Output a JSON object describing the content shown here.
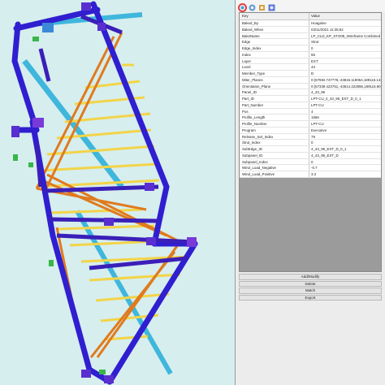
{
  "toolbar": {
    "icons": [
      "color-wheel-icon",
      "gear-icon",
      "wrench-icon",
      "filter-icon"
    ]
  },
  "properties": {
    "headers": {
      "key": "Key",
      "value": "Value"
    },
    "rows": [
      {
        "key": "Baked_By",
        "value": "Hoagaine"
      },
      {
        "key": "Baked_When",
        "value": "03/11/2021 11:35:52"
      },
      {
        "key": "BakeName",
        "value": "LP_CLD_KP_STG09_Wireframe Combined Po..."
      },
      {
        "key": "Edge",
        "value": "Strut"
      },
      {
        "key": "Edge_Index",
        "value": "0"
      },
      {
        "key": "Index",
        "value": "55"
      },
      {
        "key": "Layer",
        "value": "EXT"
      },
      {
        "key": "Level",
        "value": "43"
      },
      {
        "key": "Member_Type",
        "value": "D"
      },
      {
        "key": "Miter_Planes",
        "value": "0:(67592.747776,-43815.119054,189115.143..."
      },
      {
        "key": "Orientation_Plane",
        "value": "0:(57339.423751,-43614.222886,189115.907..."
      },
      {
        "key": "Panel_ID",
        "value": "4_43_95"
      },
      {
        "key": "Part_ID",
        "value": "LPT-CU_4_43_95_EXT_D_0_1"
      },
      {
        "key": "Part_Number",
        "value": "LPT-CU"
      },
      {
        "key": "Pos",
        "value": "4"
      },
      {
        "key": "Profile_Length",
        "value": "1556"
      },
      {
        "key": "Profile_Number",
        "value": "LPT-CU"
      },
      {
        "key": "Program",
        "value": "Executive"
      },
      {
        "key": "Release_Set_Index",
        "value": "79"
      },
      {
        "key": "Strut_Index",
        "value": "0"
      },
      {
        "key": "SubEdge_ID",
        "value": "4_43_95_EXT_D_0_1"
      },
      {
        "key": "Subpanel_ID",
        "value": "4_43_95_EXT_D"
      },
      {
        "key": "Subpanel_Index",
        "value": "0"
      },
      {
        "key": "Wind_Load_Negative",
        "value": "-0.7"
      },
      {
        "key": "Wind_Load_Positive",
        "value": "3.3"
      }
    ]
  },
  "buttons": {
    "add_modify": "Add/Modify",
    "delete": "Delete",
    "match": "Match",
    "export": "Export"
  },
  "colors": {
    "frame": "#2f1fd0",
    "strut": "#f2d448",
    "brace": "#e07a1e",
    "diagonal_cyan": "#3fb6dc",
    "node_green": "#39b54a",
    "viewport_bg": "#d6eeee"
  }
}
